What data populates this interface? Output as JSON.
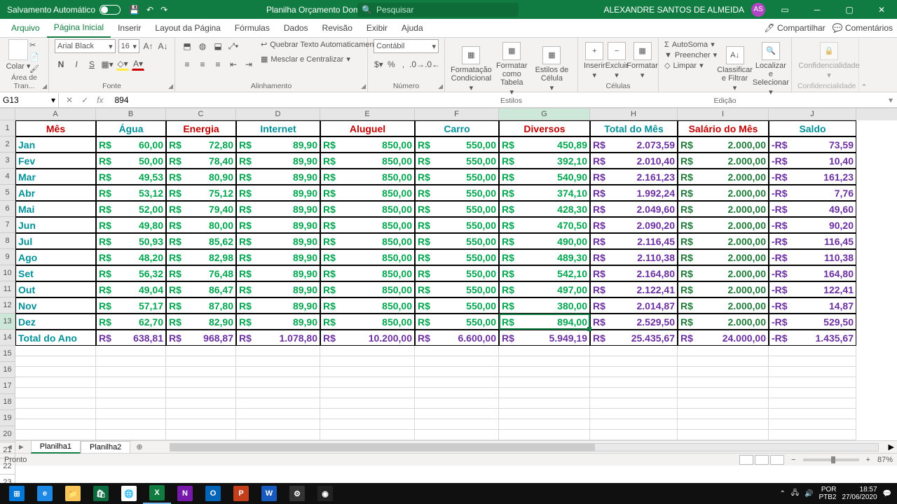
{
  "titlebar": {
    "autosave_label": "Salvamento Automático",
    "doc_name": "Planilha Orçamento Doméstico",
    "search_placeholder": "Pesquisar",
    "user_name": "ALEXANDRE SANTOS DE ALMEIDA",
    "user_initials": "AS"
  },
  "ribbon": {
    "tabs": [
      "Arquivo",
      "Página Inicial",
      "Inserir",
      "Layout da Página",
      "Fórmulas",
      "Dados",
      "Revisão",
      "Exibir",
      "Ajuda"
    ],
    "active_tab_index": 1,
    "share": "Compartilhar",
    "comments": "Comentários",
    "clipboard": {
      "paste": "Colar",
      "group": "Área de Tran..."
    },
    "font": {
      "name": "Arial Black",
      "size": "16",
      "group": "Fonte"
    },
    "alignment": {
      "wrap": "Quebrar Texto Automaticamente",
      "merge": "Mesclar e Centralizar",
      "group": "Alinhamento"
    },
    "number": {
      "format": "Contábil",
      "group": "Número"
    },
    "styles": {
      "cond": "Formatação Condicional",
      "table": "Formatar como Tabela",
      "cell": "Estilos de Célula",
      "group": "Estilos"
    },
    "cells": {
      "insert": "Inserir",
      "delete": "Excluir",
      "format": "Formatar",
      "group": "Células"
    },
    "editing": {
      "autosum": "AutoSoma",
      "fill": "Preencher",
      "clear": "Limpar",
      "sort": "Classificar e Filtrar",
      "find": "Localizar e Selecionar",
      "group": "Edição"
    },
    "confidentiality": {
      "label": "Confidencialidade",
      "group": "Confidencialidade"
    }
  },
  "formula_bar": {
    "cell_ref": "G13",
    "formula": "894"
  },
  "grid": {
    "col_letters": [
      "A",
      "B",
      "C",
      "D",
      "E",
      "F",
      "G",
      "H",
      "I",
      "J"
    ],
    "row_numbers": [
      1,
      2,
      3,
      4,
      5,
      6,
      7,
      8,
      9,
      10,
      11,
      12,
      13,
      14,
      15,
      16,
      17,
      18,
      19,
      20,
      21,
      22,
      23
    ],
    "selected": {
      "col": 6,
      "row": 12
    },
    "header_row": [
      "Mês",
      "Água",
      "Energia",
      "Internet",
      "Aluguel",
      "Carro",
      "Diversos",
      "Total do Mês",
      "Salário do Mês",
      "Saldo"
    ],
    "header_colors": [
      "c-red",
      "c-teal",
      "c-red",
      "c-teal",
      "c-red",
      "c-teal",
      "c-red",
      "c-teal",
      "c-red",
      "c-teal"
    ],
    "body_color_col0": "c-teal",
    "body_color_green": "c-green",
    "body_color_total": "c-purple",
    "body_color_salary": "c-dkgreen",
    "body_color_saldo": "c-purple",
    "total_row_label": "Total do Ano",
    "rows": [
      {
        "m": "Jan",
        "v": [
          "60,00",
          "72,80",
          "89,90",
          "850,00",
          "550,00",
          "450,89",
          "2.073,59",
          "2.000,00"
        ],
        "saldo": "73,59"
      },
      {
        "m": "Fev",
        "v": [
          "50,00",
          "78,40",
          "89,90",
          "850,00",
          "550,00",
          "392,10",
          "2.010,40",
          "2.000,00"
        ],
        "saldo": "10,40"
      },
      {
        "m": "Mar",
        "v": [
          "49,53",
          "80,90",
          "89,90",
          "850,00",
          "550,00",
          "540,90",
          "2.161,23",
          "2.000,00"
        ],
        "saldo": "161,23"
      },
      {
        "m": "Abr",
        "v": [
          "53,12",
          "75,12",
          "89,90",
          "850,00",
          "550,00",
          "374,10",
          "1.992,24",
          "2.000,00"
        ],
        "saldo": "7,76"
      },
      {
        "m": "Mai",
        "v": [
          "52,00",
          "79,40",
          "89,90",
          "850,00",
          "550,00",
          "428,30",
          "2.049,60",
          "2.000,00"
        ],
        "saldo": "49,60"
      },
      {
        "m": "Jun",
        "v": [
          "49,80",
          "80,00",
          "89,90",
          "850,00",
          "550,00",
          "470,50",
          "2.090,20",
          "2.000,00"
        ],
        "saldo": "90,20"
      },
      {
        "m": "Jul",
        "v": [
          "50,93",
          "85,62",
          "89,90",
          "850,00",
          "550,00",
          "490,00",
          "2.116,45",
          "2.000,00"
        ],
        "saldo": "116,45"
      },
      {
        "m": "Ago",
        "v": [
          "48,20",
          "82,98",
          "89,90",
          "850,00",
          "550,00",
          "489,30",
          "2.110,38",
          "2.000,00"
        ],
        "saldo": "110,38"
      },
      {
        "m": "Set",
        "v": [
          "56,32",
          "76,48",
          "89,90",
          "850,00",
          "550,00",
          "542,10",
          "2.164,80",
          "2.000,00"
        ],
        "saldo": "164,80"
      },
      {
        "m": "Out",
        "v": [
          "49,04",
          "86,47",
          "89,90",
          "850,00",
          "550,00",
          "497,00",
          "2.122,41",
          "2.000,00"
        ],
        "saldo": "122,41"
      },
      {
        "m": "Nov",
        "v": [
          "57,17",
          "87,80",
          "89,90",
          "850,00",
          "550,00",
          "380,00",
          "2.014,87",
          "2.000,00"
        ],
        "saldo": "14,87"
      },
      {
        "m": "Dez",
        "v": [
          "62,70",
          "82,90",
          "89,90",
          "850,00",
          "550,00",
          "894,00",
          "2.529,50",
          "2.000,00"
        ],
        "saldo": "529,50"
      }
    ],
    "total_row": {
      "v": [
        "638,81",
        "968,87",
        "1.078,80",
        "10.200,00",
        "6.600,00",
        "5.949,19",
        "25.435,67",
        "24.000,00"
      ],
      "saldo": "1.435,67"
    }
  },
  "sheets": {
    "tabs": [
      "Planilha1",
      "Planilha2"
    ],
    "active": 0
  },
  "statusbar": {
    "ready": "Pronto",
    "zoom": "87%"
  },
  "taskbar": {
    "lang": "POR",
    "kbd": "PTB2",
    "time": "18:57",
    "date": "27/06/2020"
  }
}
